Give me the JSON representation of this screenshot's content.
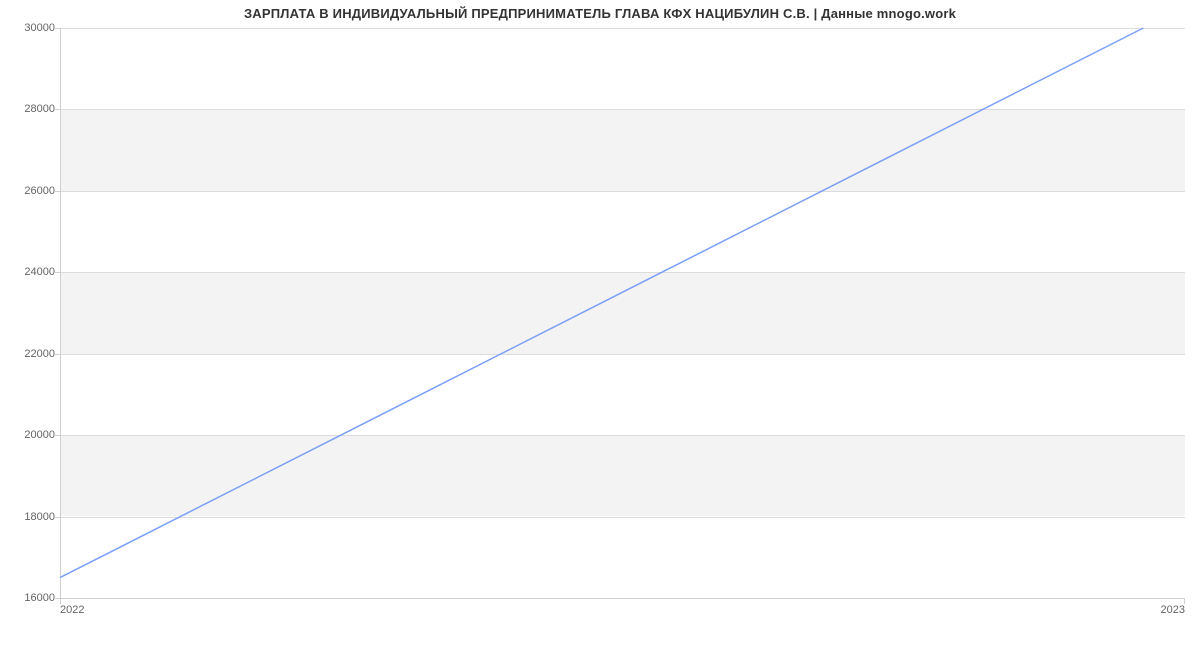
{
  "chart_data": {
    "type": "line",
    "title": "ЗАРПЛАТА В ИНДИВИДУАЛЬНЫЙ ПРЕДПРИНИМАТЕЛЬ ГЛАВА КФХ НАЦИБУЛИН С.В. | Данные mnogo.work",
    "xlabel": "",
    "ylabel": "",
    "x_ticks": [
      "2022",
      "2023"
    ],
    "y_ticks": [
      16000,
      18000,
      20000,
      22000,
      24000,
      26000,
      28000,
      30000
    ],
    "ylim": [
      16000,
      30000
    ],
    "x": [
      2021.96,
      2023.0
    ],
    "values": [
      16500,
      30000
    ],
    "line_color": "#7b9ff7",
    "band_color": "#f3f3f3",
    "grid_color": "#dcdcdc"
  }
}
